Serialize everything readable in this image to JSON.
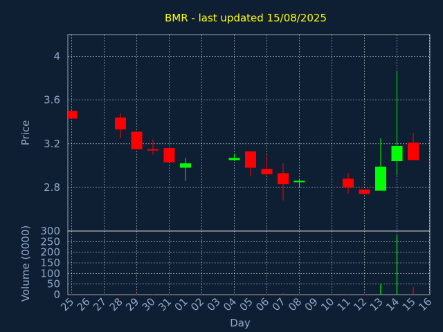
{
  "chart_data": [
    {
      "type": "candlestick",
      "title": "BMR - last updated 15/08/2025",
      "xlabel": "Day",
      "ylabel": "Price",
      "ylim": [
        2.4,
        4.2
      ],
      "yticks": [
        "2.8",
        "3.2",
        "3.6",
        "4"
      ],
      "xtick_labels": [
        "25",
        "26",
        "27",
        "28",
        "29",
        "30",
        "31",
        "01",
        "02",
        "03",
        "04",
        "05",
        "06",
        "07",
        "08",
        "09",
        "10",
        "11",
        "12",
        "13",
        "14",
        "15",
        "16"
      ],
      "grid": true,
      "colors": {
        "up": "#00ff00",
        "down": "#ff0000",
        "background": "#0f1f33",
        "grid": "#ffffff",
        "axis_text": "#8fa9c8",
        "title": "#ffff00"
      },
      "candles": [
        {
          "day": "25",
          "open": 3.5,
          "high": 3.5,
          "low": 3.43,
          "close": 3.43
        },
        {
          "day": "28",
          "open": 3.44,
          "high": 3.48,
          "low": 3.25,
          "close": 3.33
        },
        {
          "day": "29",
          "open": 3.31,
          "high": 3.31,
          "low": 3.15,
          "close": 3.15
        },
        {
          "day": "30",
          "open": 3.15,
          "high": 3.24,
          "low": 3.1,
          "close": 3.14
        },
        {
          "day": "31",
          "open": 3.16,
          "high": 3.25,
          "low": 3.03,
          "close": 3.03
        },
        {
          "day": "01",
          "open": 2.98,
          "high": 3.07,
          "low": 2.86,
          "close": 3.02
        },
        {
          "day": "04",
          "open": 3.05,
          "high": 3.11,
          "low": 3.04,
          "close": 3.07
        },
        {
          "day": "05",
          "open": 3.13,
          "high": 3.13,
          "low": 2.9,
          "close": 2.98
        },
        {
          "day": "06",
          "open": 2.97,
          "high": 3.09,
          "low": 2.91,
          "close": 2.92
        },
        {
          "day": "07",
          "open": 2.93,
          "high": 3.02,
          "low": 2.68,
          "close": 2.83
        },
        {
          "day": "08",
          "open": 2.85,
          "high": 2.87,
          "low": 2.8,
          "close": 2.86
        },
        {
          "day": "11",
          "open": 2.88,
          "high": 2.93,
          "low": 2.74,
          "close": 2.8
        },
        {
          "day": "12",
          "open": 2.78,
          "high": 2.78,
          "low": 2.74,
          "close": 2.74
        },
        {
          "day": "13",
          "open": 2.77,
          "high": 3.25,
          "low": 2.77,
          "close": 2.99
        },
        {
          "day": "14",
          "open": 3.04,
          "high": 3.86,
          "low": 2.91,
          "close": 3.18
        },
        {
          "day": "15",
          "open": 3.21,
          "high": 3.3,
          "low": 3.05,
          "close": 3.05
        }
      ]
    },
    {
      "type": "bar",
      "ylabel": "Volume (0000)",
      "ylim": [
        0,
        300
      ],
      "yticks": [
        "0",
        "50",
        "100",
        "150",
        "200",
        "250",
        "300"
      ],
      "grid": true,
      "categories": [
        "25",
        "28",
        "29",
        "30",
        "31",
        "01",
        "04",
        "05",
        "06",
        "07",
        "08",
        "11",
        "12",
        "13",
        "14",
        "15"
      ],
      "values": [
        2,
        5,
        6,
        2,
        3,
        2,
        1,
        3,
        3,
        7,
        1,
        2,
        3,
        50,
        280,
        35
      ],
      "bar_colors": [
        "down",
        "down",
        "down",
        "down",
        "down",
        "up",
        "up",
        "down",
        "down",
        "down",
        "up",
        "down",
        "down",
        "up",
        "up",
        "down"
      ]
    }
  ]
}
